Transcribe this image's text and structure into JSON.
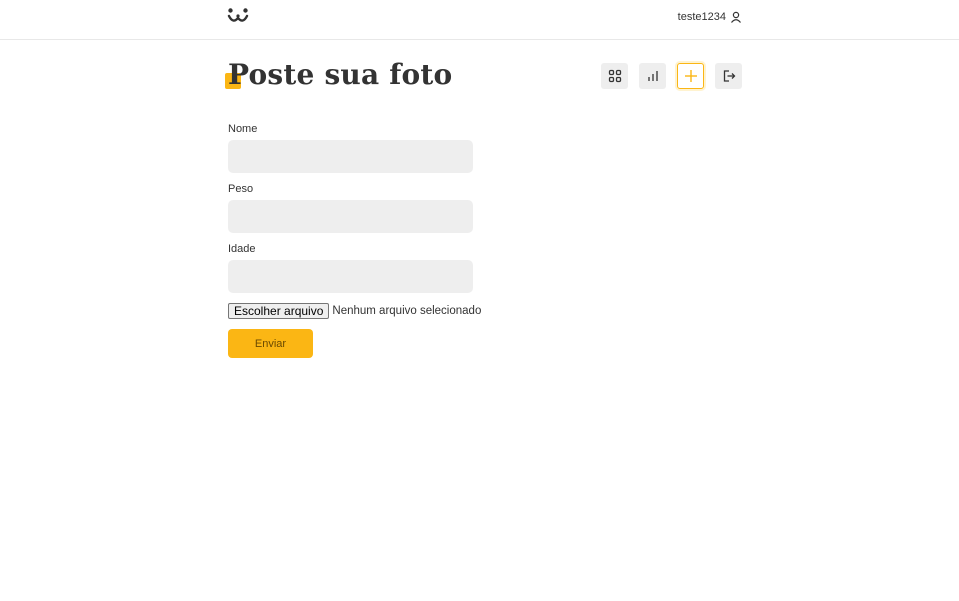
{
  "header": {
    "logo_icon": "dog-face-logo-icon",
    "username": "teste1234",
    "user_icon": "user-icon"
  },
  "page": {
    "title": "Poste sua foto",
    "accent_color": "#fbb614"
  },
  "nav": {
    "items": [
      {
        "icon": "grid-icon",
        "active": false
      },
      {
        "icon": "bar-chart-icon",
        "active": false
      },
      {
        "icon": "plus-icon",
        "active": true
      },
      {
        "icon": "logout-icon",
        "active": false
      }
    ]
  },
  "form": {
    "fields": [
      {
        "label": "Nome",
        "value": ""
      },
      {
        "label": "Peso",
        "value": ""
      },
      {
        "label": "Idade",
        "value": ""
      }
    ],
    "file_button_label": "Escolher arquivo",
    "file_status": "Nenhum arquivo selecionado",
    "submit_label": "Enviar"
  }
}
